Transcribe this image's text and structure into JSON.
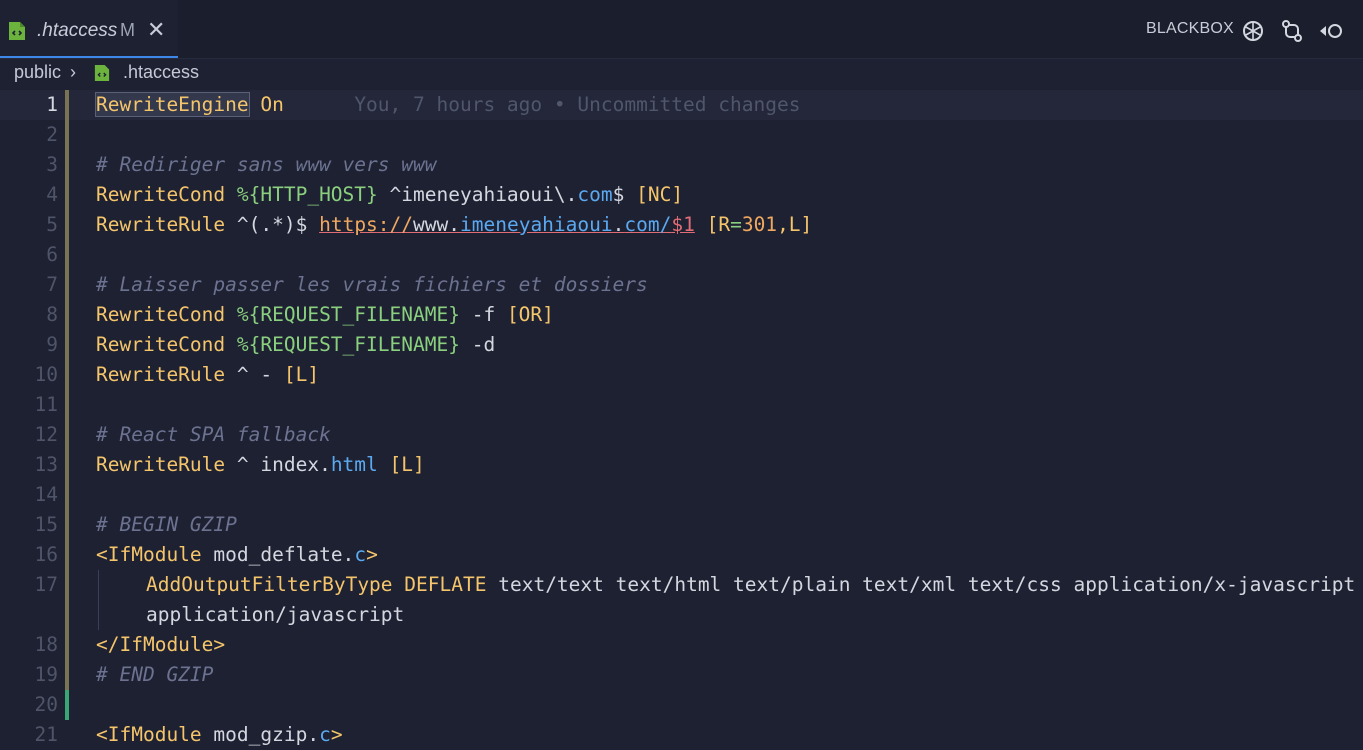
{
  "tab": {
    "filename": ".htaccess",
    "modified": "M",
    "close": "✕"
  },
  "actions": {
    "label": "BLACKBOX"
  },
  "breadcrumb": {
    "folder": "public",
    "file": ".htaccess"
  },
  "blame": "You, 7 hours ago • Uncommitted changes",
  "lines": {
    "n1": "1",
    "n2": "2",
    "n3": "3",
    "n4": "4",
    "n5": "5",
    "n6": "6",
    "n7": "7",
    "n8": "8",
    "n9": "9",
    "n10": "10",
    "n11": "11",
    "n12": "12",
    "n13": "13",
    "n14": "14",
    "n15": "15",
    "n16": "16",
    "n17": "17",
    "n18": "18",
    "n19": "19",
    "n20": "20",
    "n21": "21"
  },
  "code": {
    "l1_kw": "RewriteEngine",
    "l1_val": "On",
    "l3": "# Rediriger sans www vers www",
    "l4_kw": "RewriteCond",
    "l4_var": "%{HTTP_HOST}",
    "l4_rest": "^imeneyahiaoui\\.",
    "l4_com": "com",
    "l4_end": "$",
    "l4_flag": "[NC]",
    "l5_kw": "RewriteRule",
    "l5_pat": "^(.*)$",
    "l5_proto": "https",
    "l5_sep": "://",
    "l5_www": "www.",
    "l5_host": "imeneyahiaoui",
    "l5_dot": ".",
    "l5_tld": "com",
    "l5_slash": "/",
    "l5_var": "$1",
    "l5_flag_open": "[R",
    "l5_eq": "=",
    "l5_num": "301",
    "l5_flag_close": ",L]",
    "l7": "# Laisser passer les vrais fichiers et dossiers",
    "l8_kw": "RewriteCond",
    "l8_var": "%{REQUEST_FILENAME}",
    "l8_opt": "-f",
    "l8_flag": "[OR]",
    "l9_kw": "RewriteCond",
    "l9_var": "%{REQUEST_FILENAME}",
    "l9_opt": "-d",
    "l10_kw": "RewriteRule",
    "l10_rest": "^ -",
    "l10_flag": "[L]",
    "l12": "# React SPA fallback",
    "l13_kw": "RewriteRule",
    "l13_rest": "^ index.",
    "l13_ext": "html",
    "l13_flag": "[L]",
    "l15": "# BEGIN GZIP",
    "l16_open": "<IfModule",
    "l16_mod": "mod_deflate.",
    "l16_c": "c",
    "l16_close": ">",
    "l17_kw": "AddOutputFilterByType",
    "l17_type": "DEFLATE",
    "l17_rest": "text/text text/html text/plain text/xml text/css application/x-javascript",
    "l17b": "application/javascript",
    "l18": "</IfModule>",
    "l19": "# END GZIP",
    "l21_open": "<IfModule",
    "l21_mod": "mod_gzip.",
    "l21_c": "c",
    "l21_close": ">"
  },
  "colors": {
    "background": "#1e2132",
    "keyword": "#f5c56b",
    "comment": "#6c7290",
    "variable": "#8ad07e",
    "accent": "#3d87e8"
  }
}
